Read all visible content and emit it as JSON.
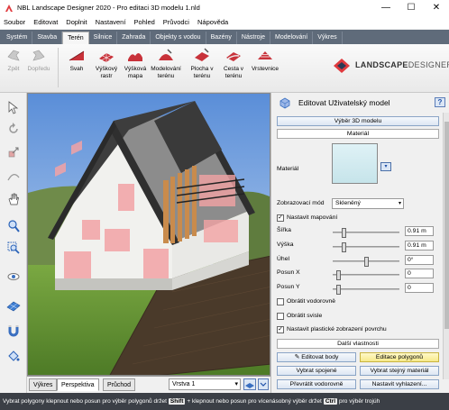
{
  "window": {
    "title": "NBL Landscape Designer 2020 - Pro editaci 3D modelu 1.nld",
    "minimize": "—",
    "maximize": "☐",
    "close": "✕"
  },
  "menu": [
    "Soubor",
    "Editovat",
    "Doplnit",
    "Nastavení",
    "Pohled",
    "Průvodci",
    "Nápověda"
  ],
  "tabs": [
    "Systém",
    "Stavba",
    "Terén",
    "Silnice",
    "Zahrada",
    "Objekty s vodou",
    "Bazény",
    "Nástroje",
    "Modelování",
    "Výkres"
  ],
  "active_tab": "Terén",
  "ribbon": {
    "back": "Zpět",
    "forward": "Dopředu",
    "buttons": [
      {
        "l1": "Svah",
        "l2": ""
      },
      {
        "l1": "Výškový",
        "l2": "rastr"
      },
      {
        "l1": "Výšková",
        "l2": "mapa"
      },
      {
        "l1": "Modelování",
        "l2": "terénu"
      },
      {
        "l1": "Plocha v",
        "l2": "terénu"
      },
      {
        "l1": "Cesta v",
        "l2": "terénu"
      },
      {
        "l1": "Vrstevnice",
        "l2": ""
      }
    ]
  },
  "brand": {
    "part1": "LANDSCAPE",
    "part2": "DESIGNER",
    "accent": "#e03a3e"
  },
  "view_tabs": [
    "Výkres",
    "Perspektiva",
    "Průchod"
  ],
  "active_view": "Perspektiva",
  "layer": "Vrstva 1",
  "panel": {
    "title": "Editovat Uživatelský model",
    "help": "?",
    "select_model": "Výběr 3D modelu",
    "material_section": "Materiál",
    "material_label": "Materiál",
    "display_mode_label": "Zobrazovací mód",
    "display_mode_value": "Skleněný",
    "set_mapping": "Nastavit mapování",
    "rows": [
      {
        "label": "Šířka",
        "value": "0.91 m"
      },
      {
        "label": "Výška",
        "value": "0.91 m"
      },
      {
        "label": "Úhel",
        "value": "0°"
      },
      {
        "label": "Posun X",
        "value": "0"
      },
      {
        "label": "Posun Y",
        "value": "0"
      }
    ],
    "flip_h": "Obrátit vodorovně",
    "flip_v": "Obrátit svisle",
    "plastic": "Nastavit plastické zobrazení povrchu",
    "more": "Další vlastnosti",
    "btn_edit_points": "Editovat body",
    "btn_edit_polygons": "Editace polygonů",
    "btn_select_connected": "Vybrat spojené",
    "btn_select_same_material": "Vybrat stejný materiál",
    "btn_flip_h": "Převrátit vodorovně",
    "btn_smoothing": "Nastavit vyhlazení..."
  },
  "status": {
    "t1": "Vybrat polygony",
    "t2": "klepnout nebo posun",
    "t3": "pro výběr polygonů",
    "t4": "držet",
    "k1": "Shift",
    "t5": "+ klepnout nebo posun",
    "t6": "pro vícenásobný výběr",
    "t7": "držet",
    "k2": "Ctrl",
    "t8": "pro výběr trojúh"
  }
}
